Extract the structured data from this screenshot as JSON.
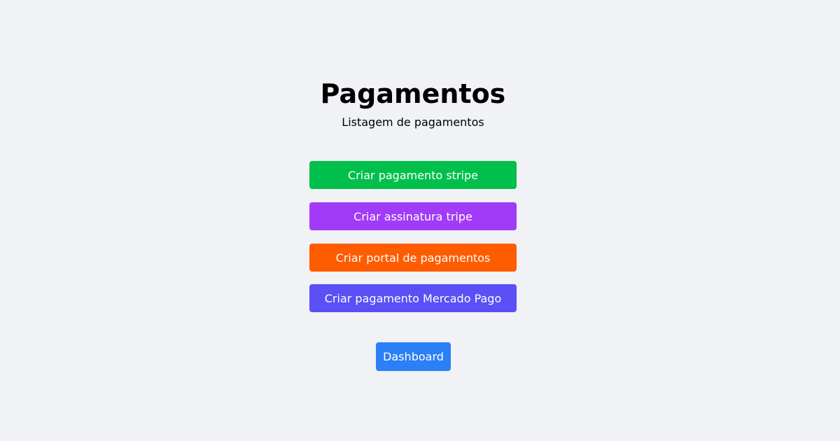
{
  "header": {
    "title": "Pagamentos",
    "subtitle": "Listagem de pagamentos"
  },
  "actions": [
    {
      "label": "Criar pagamento stripe",
      "color": "#00c04b"
    },
    {
      "label": "Criar assinatura tripe",
      "color": "#a13bf7"
    },
    {
      "label": "Criar portal de pagamentos",
      "color": "#ff5c00"
    },
    {
      "label": "Criar pagamento Mercado Pago",
      "color": "#5a50f5"
    }
  ],
  "dashboard": {
    "label": "Dashboard",
    "color": "#2b7ff7"
  }
}
